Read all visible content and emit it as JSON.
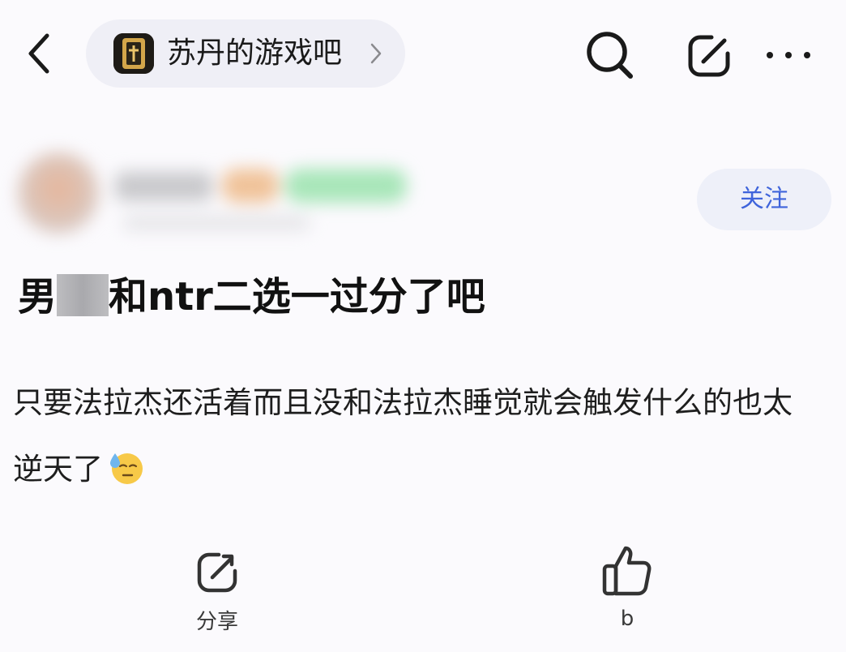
{
  "nav": {
    "forum_name": "苏丹的游戏吧",
    "forum_avatar_icon": "forum-avatar-icon",
    "back_icon": "chevron-left-icon",
    "search_icon": "search-icon",
    "compose_icon": "edit-icon",
    "more_icon": "more-horizontal-icon"
  },
  "author": {
    "follow_label": "关注"
  },
  "post": {
    "title_prefix": "男",
    "title_suffix": "和ntr二选一过分了吧",
    "body": "只要法拉杰还活着而且没和法拉杰睡觉就会触发什么的也太逆天了",
    "emoji": "sweat-smile-emoji"
  },
  "actions": {
    "share_label": "分享",
    "like_label": "b"
  },
  "colors": {
    "accent": "#3f64db",
    "background": "#fbfafd",
    "pill": "#efeff6"
  }
}
